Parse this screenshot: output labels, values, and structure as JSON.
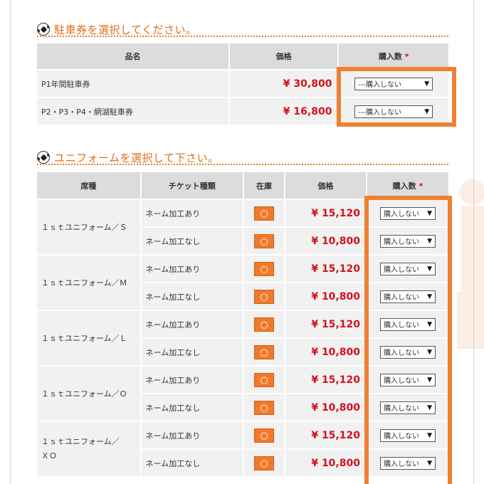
{
  "parking": {
    "title": "駐車券を選択してください。",
    "headers": {
      "name": "品名",
      "price": "価格",
      "qty": "購入数",
      "required": "*"
    },
    "rows": [
      {
        "name": "P1年間駐車券",
        "price": "¥ 30,800",
        "select": "---購入しない"
      },
      {
        "name": "P2・P3・P4・網湖駐車券",
        "price": "¥ 16,800",
        "select": "---購入しない"
      }
    ]
  },
  "uniform": {
    "title": "ユニフォームを選択して下さい。",
    "headers": {
      "seat": "席種",
      "ticket": "チケット種類",
      "stock": "在庫",
      "price": "価格",
      "qty": "購入数",
      "required": "*"
    },
    "groups": [
      {
        "seat": "１ｓｔユニフォーム／Ｓ",
        "rows": [
          {
            "type": "ネーム加工あり",
            "stock": "○",
            "price": "¥ 15,120",
            "select": "購入しない"
          },
          {
            "type": "ネーム加工なし",
            "stock": "○",
            "price": "¥ 10,800",
            "select": "購入しない"
          }
        ]
      },
      {
        "seat": "１ｓｔユニフォーム／Ｍ",
        "rows": [
          {
            "type": "ネーム加工あり",
            "stock": "○",
            "price": "¥ 15,120",
            "select": "購入しない"
          },
          {
            "type": "ネーム加工なし",
            "stock": "○",
            "price": "¥ 10,800",
            "select": "購入しない"
          }
        ]
      },
      {
        "seat": "１ｓｔユニフォーム／Ｌ",
        "rows": [
          {
            "type": "ネーム加工あり",
            "stock": "○",
            "price": "¥ 15,120",
            "select": "購入しない"
          },
          {
            "type": "ネーム加工なし",
            "stock": "○",
            "price": "¥ 10,800",
            "select": "購入しない"
          }
        ]
      },
      {
        "seat": "１ｓｔユニフォーム／Ｏ",
        "rows": [
          {
            "type": "ネーム加工あり",
            "stock": "○",
            "price": "¥ 15,120",
            "select": "購入しない"
          },
          {
            "type": "ネーム加工なし",
            "stock": "○",
            "price": "¥ 10,800",
            "select": "購入しない"
          }
        ]
      },
      {
        "seat": "１ｓｔユニフォーム／ＸＯ",
        "rows": [
          {
            "type": "ネーム加工あり",
            "stock": "○",
            "price": "¥ 15,120",
            "select": "購入しない"
          },
          {
            "type": "ネーム加工なし",
            "stock": "○",
            "price": "¥ 10,800",
            "select": "購入しない"
          }
        ]
      }
    ]
  },
  "icons": {
    "section": "soccer-ball-icon",
    "dropdown": "triangle-down-icon"
  },
  "colors": {
    "accent": "#e06d18",
    "price": "#d2121e",
    "highlight": "#f08030",
    "stock": "#f07a2a"
  }
}
